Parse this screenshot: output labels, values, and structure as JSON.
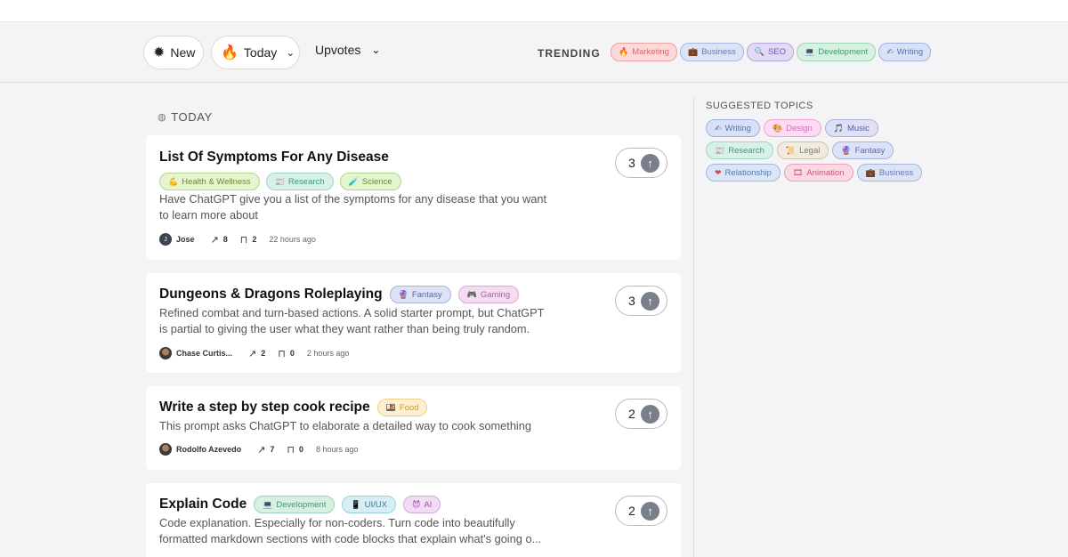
{
  "filters": {
    "new_label": "New",
    "new_icon": "sparkle-icon",
    "period_label": "Today",
    "period_icon": "fire-icon",
    "sort_label": "Upvotes"
  },
  "trending": {
    "label": "TRENDING",
    "tags": [
      {
        "label": "Marketing",
        "icon": "🔥"
      },
      {
        "label": "Business",
        "icon": "💼"
      },
      {
        "label": "SEO",
        "icon": "🔍"
      },
      {
        "label": "Development",
        "icon": "💻"
      },
      {
        "label": "Writing",
        "icon": "✍"
      }
    ]
  },
  "feed": {
    "section_label": "TODAY",
    "posts": [
      {
        "title": "List Of Symptoms For Any Disease",
        "tags": [
          {
            "label": "Health & Wellness",
            "icon": "💪"
          },
          {
            "label": "Research",
            "icon": "📰"
          },
          {
            "label": "Science",
            "icon": "🧪"
          }
        ],
        "description": "Have ChatGPT give you a list of the symptoms for any disease that you want to learn more about",
        "author": "Jose",
        "author_initial": "J",
        "shares": "8",
        "saves": "2",
        "time": "22 hours ago",
        "votes": "3"
      },
      {
        "title": "Dungeons & Dragons Roleplaying",
        "tags": [
          {
            "label": "Fantasy",
            "icon": "🔮"
          },
          {
            "label": "Gaming",
            "icon": "🎮"
          }
        ],
        "description": "Refined combat and turn-based actions. A solid starter prompt, but ChatGPT is partial to giving the user what they want rather than being truly random.",
        "author": "Chase Curtis...",
        "shares": "2",
        "saves": "0",
        "time": "2 hours ago",
        "votes": "3"
      },
      {
        "title": "Write a step by step cook recipe",
        "tags": [
          {
            "label": "Food",
            "icon": "🍱"
          }
        ],
        "description": "This prompt asks ChatGPT to elaborate a detailed way to cook something",
        "author": "Rodolfo Azevedo",
        "shares": "7",
        "saves": "0",
        "time": "8 hours ago",
        "votes": "2"
      },
      {
        "title": "Explain Code",
        "tags": [
          {
            "label": "Development",
            "icon": "💻"
          },
          {
            "label": "UI/UX",
            "icon": "📱"
          },
          {
            "label": "AI",
            "icon": "😈"
          }
        ],
        "description": "Code explanation. Especially for non-coders. Turn code into beautifully formatted markdown sections with code blocks that explain what's going o...",
        "votes": "2"
      }
    ]
  },
  "suggested": {
    "label": "SUGGESTED TOPICS",
    "tags": [
      {
        "label": "Writing",
        "icon": "✍"
      },
      {
        "label": "Design",
        "icon": "🎨"
      },
      {
        "label": "Music",
        "icon": "🎵"
      },
      {
        "label": "Research",
        "icon": "📰"
      },
      {
        "label": "Legal",
        "icon": "📜"
      },
      {
        "label": "Fantasy",
        "icon": "🔮"
      },
      {
        "label": "Relationship",
        "icon": "❤"
      },
      {
        "label": "Animation",
        "icon": "🎞"
      },
      {
        "label": "Business",
        "icon": "💼"
      }
    ]
  },
  "icons": {
    "share": "share-arrow-icon",
    "save": "bookmark-icon",
    "upvote": "upvote-arrow-icon"
  }
}
